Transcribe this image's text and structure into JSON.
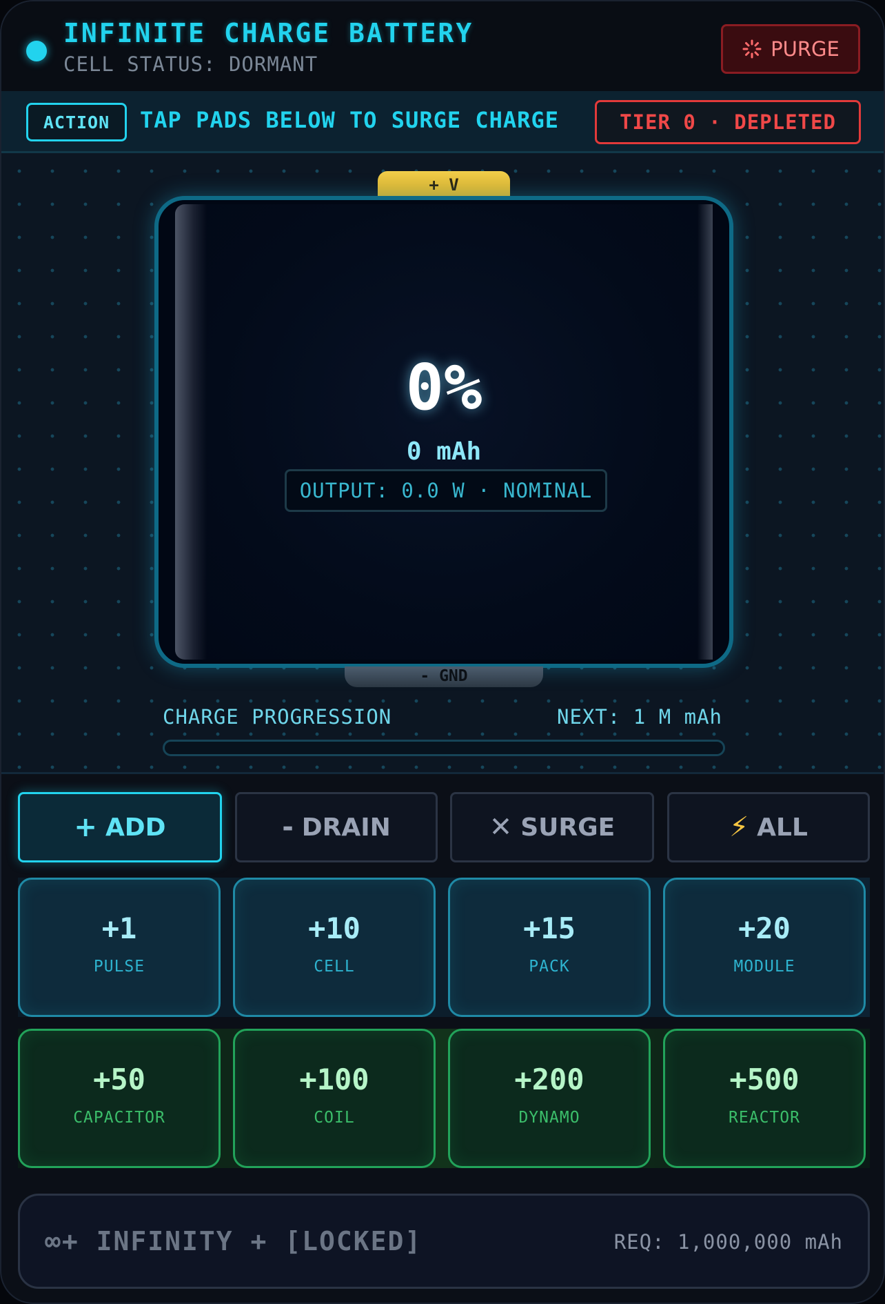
{
  "header": {
    "title": "INFINITE CHARGE BATTERY",
    "cell_status": "CELL STATUS: DORMANT",
    "purge_label": "PURGE"
  },
  "action_bar": {
    "tag": "ACTION",
    "instruction": "TAP PADS BELOW TO SURGE CHARGE",
    "tier": "TIER 0 · DEPLETED"
  },
  "battery": {
    "positive_terminal": "+ V",
    "negative_terminal": "- GND",
    "percent_text": "0%",
    "mah_text": "0 mAh",
    "output_text": "OUTPUT: 0.0 W · NOMINAL",
    "charge_fraction": 0
  },
  "progression": {
    "label": "CHARGE PROGRESSION",
    "next": "NEXT: 1 M mAh",
    "fraction": 0
  },
  "modes": [
    {
      "glyph": "+",
      "label": "ADD",
      "active": true
    },
    {
      "glyph": "-",
      "label": "DRAIN",
      "active": false
    },
    {
      "glyph": "✕",
      "label": "SURGE",
      "active": false
    },
    {
      "glyph": "⚡",
      "label": "ALL",
      "active": false
    }
  ],
  "pads": [
    {
      "amount": "+1",
      "kind": "PULSE"
    },
    {
      "amount": "+10",
      "kind": "CELL"
    },
    {
      "amount": "+15",
      "kind": "PACK"
    },
    {
      "amount": "+20",
      "kind": "MODULE"
    },
    {
      "amount": "+50",
      "kind": "CAPACITOR"
    },
    {
      "amount": "+100",
      "kind": "COIL"
    },
    {
      "amount": "+200",
      "kind": "DYNAMO"
    },
    {
      "amount": "+500",
      "kind": "REACTOR"
    }
  ],
  "infinity": {
    "label": "∞+ INFINITY + [LOCKED]",
    "requirement": "REQ: 1,000,000 mAh"
  },
  "colors": {
    "accent": "#22d3ee",
    "danger": "#f04848",
    "pad_blue": "#1f8aa6",
    "pad_green": "#22a35a"
  }
}
